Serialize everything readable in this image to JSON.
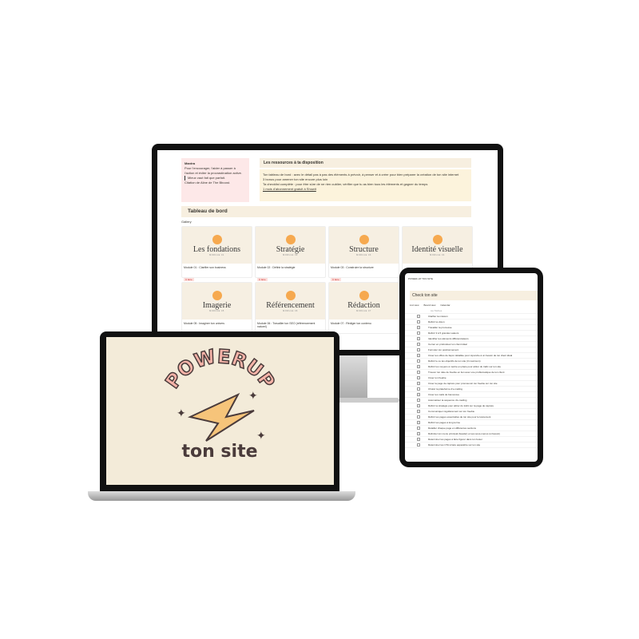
{
  "monitor": {
    "mantra": {
      "title": "Mantra",
      "text": "Pour l'encourager, l'aider à passer à l'action et éviter la procrastination active.",
      "quote": "Mieux vaut fait que parfait.",
      "citation": "Citation de Aline de The Bboost."
    },
    "resources": {
      "title": "Les ressources à ta disposition",
      "items": [
        "Ton tableau de bord : avec le détail pas à pas des éléments à prévoir, à penser et à créer pour bien préparer la création de ton site internet",
        "3 bonus pour amener ton site encore plus loin",
        "Ta checklist complète : pour être sûre de ne rien oublier, vérifier que tu as bien tous les éléments et gagner du temps",
        "1 mois d'abonnement gratuit à Showit"
      ]
    },
    "dashboard": {
      "title": "Tableau de bord",
      "view": "Gallery"
    },
    "cards": [
      {
        "title": "Les fondations",
        "module": "MODULE 01",
        "caption": "Module 01 : Clarifier son business",
        "tag": "À faire"
      },
      {
        "title": "Stratégie",
        "module": "MODULE 02",
        "caption": "Module 02 : Définir la stratégie",
        "tag": "À faire"
      },
      {
        "title": "Structure",
        "module": "MODULE 03",
        "caption": "Module 03 : Construire la structure",
        "tag": "À faire"
      },
      {
        "title": "Identité visuelle",
        "module": "MODULE 04",
        "caption": "",
        "tag": ""
      },
      {
        "title": "Imagerie",
        "module": "MODULE 05",
        "caption": "Module 05 : Imaginer ton univers",
        "tag": ""
      },
      {
        "title": "Référencement",
        "module": "MODULE 06",
        "caption": "Module 06 : Travailler ton SEO (référencement naturel)",
        "tag": ""
      },
      {
        "title": "Rédaction",
        "module": "MODULE 07",
        "caption": "Module 07 : Rédiger ton contenu",
        "tag": ""
      }
    ]
  },
  "laptop": {
    "logo_top": "POWERUP",
    "logo_bottom": "ton site"
  },
  "tablet": {
    "breadcrumb": "POWER-UP TON SITE",
    "title": "Check ton site",
    "views": [
      "List view",
      "Board view",
      "Calendar"
    ],
    "column": "Aa Tâches",
    "tasks": [
      "Clarifier ta mission",
      "Définir ta vision",
      "Travailler ta promesse",
      "Définir 3 à 5 grandes valeurs",
      "Identifier tes éléments différenciateurs",
      "Cerner en profondeur ton client idéal",
      "Formuler ton positionnement",
      "Créer tes offres de façon détaillée pour répondre à un besoin de ton client idéal",
      "Définir le ou les objectifs de ton site (3 maximum)",
      "Définir les moyens à mettre en place pour attirer du trafic sur ton site",
      "Trouver ton idée de freebie en lien avec une problématique de ton client",
      "Créer ton freebie",
      "Créer ta page de capture pour promouvoir ton freebie sur ton site",
      "Choisir ta plateforme d'e-mailing",
      "Créer tes mails de bienvenue",
      "Automatiser ta séquence d'e-mailing",
      "Définir ta stratégie pour attirer du trafic sur ta page de capture",
      "Communiquer régulièrement sur ton freebie",
      "Définir tes pages essentielles de ton site pour le lancement",
      "Définir tes pages à long terme",
      "Détailler chaque page en différentes sections",
      "Délimiter ton menu principal (header) et ses sous-menus (si besoin)",
      "Déterminer les pages à faire figurer dans ton footer",
      "Déterminer les CTA à faire apparaître sur ton site"
    ]
  },
  "colors": {
    "cream": "#f3ebd9",
    "pink": "#f5b3a8",
    "orange": "#f6a94f"
  }
}
